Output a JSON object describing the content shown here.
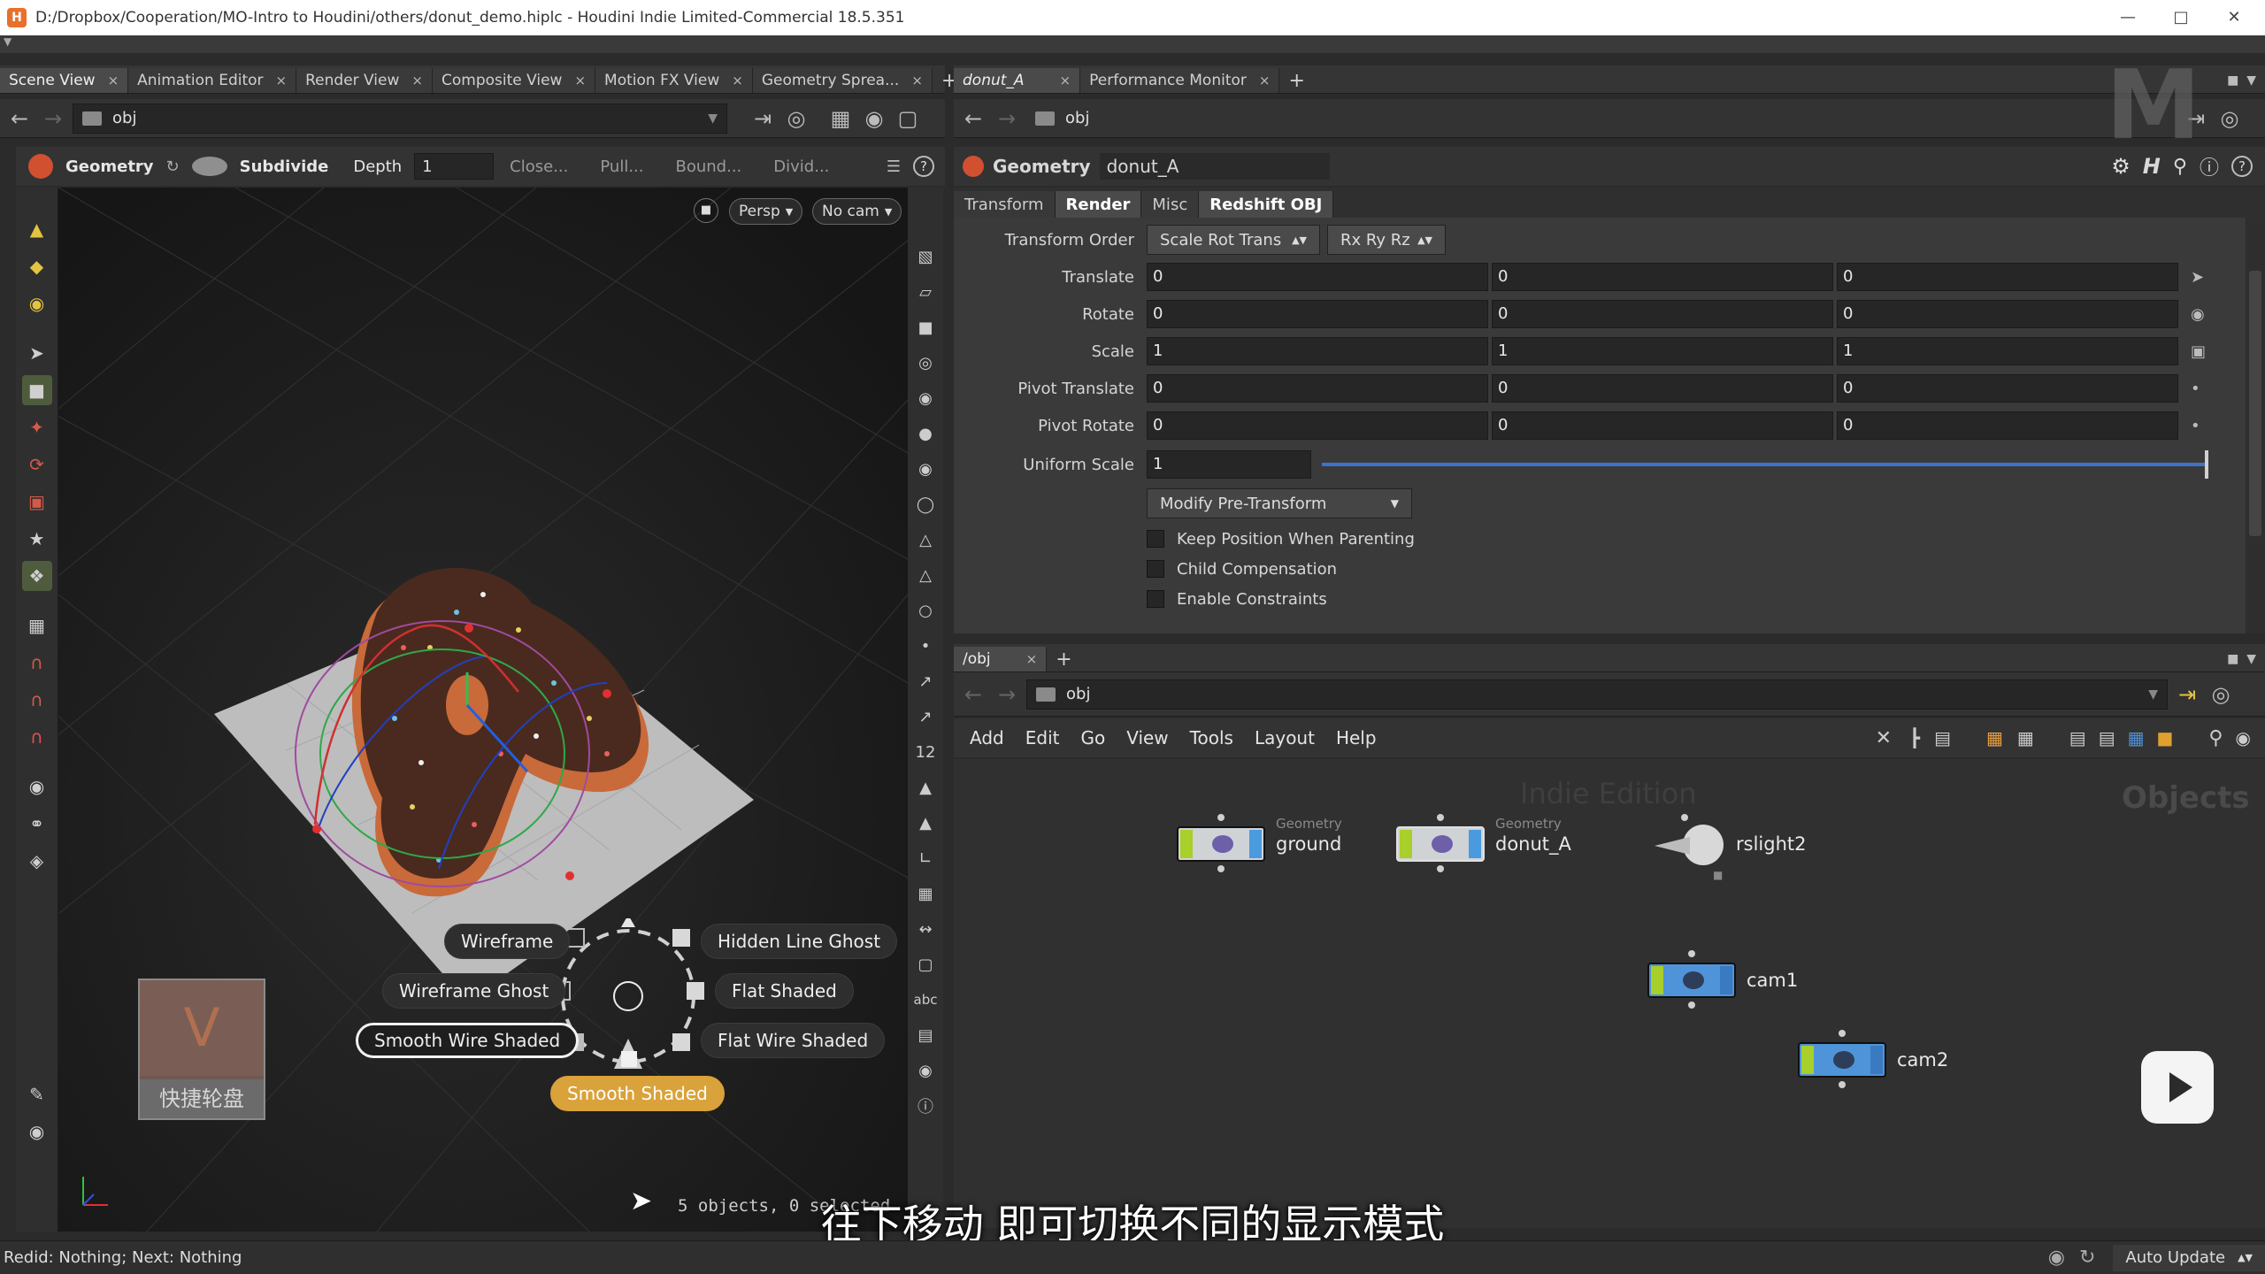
{
  "window": {
    "title": "D:/Dropbox/Cooperation/MO-Intro to Houdini/others/donut_demo.hiplc - Houdini Indie Limited-Commercial 18.5.351",
    "app_icon": "houdini-icon"
  },
  "left_pane": {
    "tabs": [
      {
        "label": "Scene View",
        "active": true
      },
      {
        "label": "Animation Editor"
      },
      {
        "label": "Render View"
      },
      {
        "label": "Composite View"
      },
      {
        "label": "Motion FX View"
      },
      {
        "label": "Geometry Sprea..."
      }
    ],
    "path": "obj",
    "toolbar": {
      "context_label": "Geometry",
      "tool_label": "Subdivide",
      "depth_label": "Depth",
      "depth_value": "1",
      "closure_label": "Close...",
      "pull_label": "Pull...",
      "boundary_label": "Bound...",
      "divide_label": "Divid..."
    },
    "viewport": {
      "persp_label": "Persp",
      "cam_label": "No cam",
      "status_text": "5 objects, 0 selected",
      "display_modes": {
        "wireframe": "Wireframe",
        "hidden_line_ghost": "Hidden Line Ghost",
        "wireframe_ghost": "Wireframe Ghost",
        "flat_shaded": "Flat Shaded",
        "smooth_wire_shaded": "Smooth Wire Shaded",
        "flat_wire_shaded": "Flat Wire Shaded",
        "smooth_shaded": "Smooth Shaded"
      },
      "shortcut_label": "快捷轮盘"
    }
  },
  "right_pane": {
    "tabs": [
      {
        "label": "donut_A",
        "active": true
      },
      {
        "label": "Performance Monitor"
      }
    ],
    "path": "obj",
    "node_type": "Geometry",
    "node_name": "donut_A",
    "param_tabs": [
      {
        "label": "Transform"
      },
      {
        "label": "Render",
        "active": true
      },
      {
        "label": "Misc"
      },
      {
        "label": "Redshift OBJ",
        "active": true
      }
    ],
    "params": {
      "transform_order_label": "Transform Order",
      "transform_order_value": "Scale Rot Trans",
      "rotate_order_value": "Rx Ry Rz",
      "translate_label": "Translate",
      "translate": [
        "0",
        "0",
        "0"
      ],
      "rotate_label": "Rotate",
      "rotate": [
        "0",
        "0",
        "0"
      ],
      "scale_label": "Scale",
      "scale": [
        "1",
        "1",
        "1"
      ],
      "pivot_translate_label": "Pivot Translate",
      "pivot_translate": [
        "0",
        "0",
        "0"
      ],
      "pivot_rotate_label": "Pivot Rotate",
      "pivot_rotate": [
        "0",
        "0",
        "0"
      ],
      "uniform_scale_label": "Uniform Scale",
      "uniform_scale": "1",
      "modify_menu": "Modify Pre-Transform",
      "keep_position_label": "Keep Position When Parenting",
      "child_comp_label": "Child Compensation",
      "enable_constraints_label": "Enable Constraints"
    }
  },
  "network": {
    "tab_label": "/obj",
    "path": "obj",
    "menu": [
      "Add",
      "Edit",
      "Go",
      "View",
      "Tools",
      "Layout",
      "Help"
    ],
    "watermark": "Indie Edition",
    "context_label": "Objects",
    "nodes": [
      {
        "type": "Geometry",
        "name": "ground"
      },
      {
        "type": "Geometry",
        "name": "donut_A"
      },
      {
        "type": "",
        "name": "rslight2"
      },
      {
        "type": "",
        "name": "cam1"
      },
      {
        "type": "",
        "name": "cam2"
      }
    ]
  },
  "status": {
    "message": "Redid: Nothing; Next: Nothing",
    "auto_update": "Auto Update"
  },
  "subtitle": "往下移动 即可切换不同的显示模式"
}
